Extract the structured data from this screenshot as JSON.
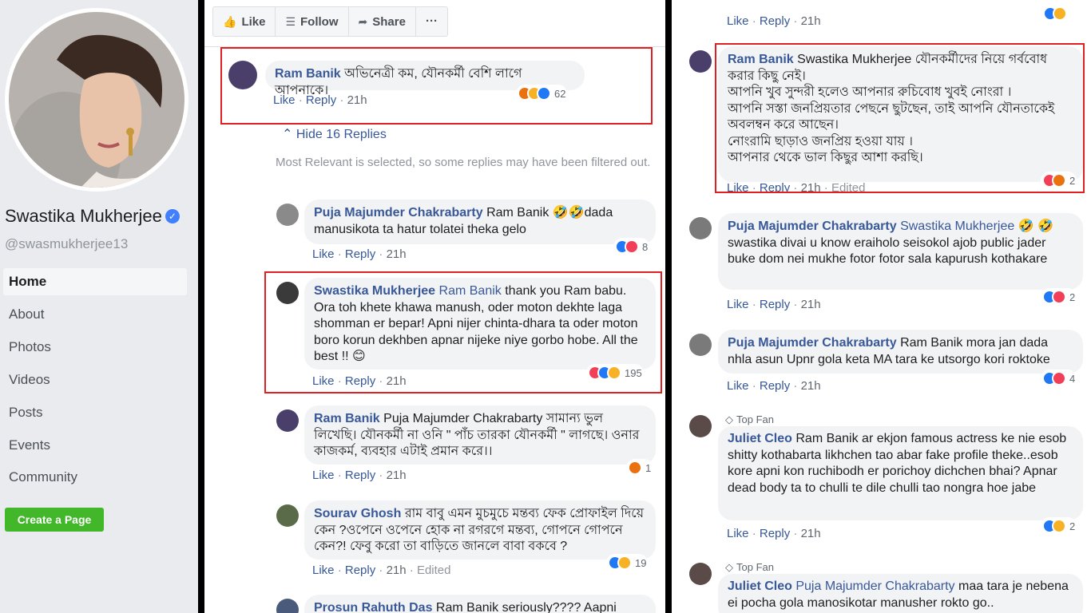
{
  "profile": {
    "name": "Swastika Mukherjee",
    "handle": "@swasmukherjee13",
    "verified_icon": "✓",
    "nav": [
      "Home",
      "About",
      "Photos",
      "Videos",
      "Posts",
      "Events",
      "Community"
    ],
    "active_nav": "Home",
    "create_page": "Create a Page"
  },
  "action_bar": {
    "like": "Like",
    "follow": "Follow",
    "share": "Share",
    "more": "···"
  },
  "meta_labels": {
    "like": "Like",
    "reply": "Reply",
    "time": "21h",
    "edited": "Edited",
    "sep": "·"
  },
  "hide_replies": "Hide 16 Replies",
  "filter_note": "Most Relevant is selected, so some replies may have been filtered out.",
  "top_fan_label": "Top Fan",
  "mid_comments": [
    {
      "author": "Ram Banik",
      "tag": "",
      "text": "অভিনেত্রী কম, যৌনকর্মী বেশি লাগে আপনাকে।",
      "reactions": "62"
    },
    {
      "author": "Puja Majumder Chakrabarty",
      "tag": "",
      "text": "Ram Banik 🤣🤣dada manusikota ta hatur tolatei theka gelo",
      "reactions": "8"
    },
    {
      "author": "Swastika Mukherjee",
      "tag": "Ram Banik",
      "text": "thank you Ram babu. Ora toh khete khawa manush, oder moton dekhte laga shomman er bepar! Apni nijer chinta-dhara ta oder moton boro korun dekhben apnar nijeke niye gorbo hobe. All the best !! 😊",
      "reactions": "195"
    },
    {
      "author": "Ram Banik",
      "tag": "",
      "text": "Puja Majumder Chakrabarty সামান্য ভুল লিখেছি। যৌনকর্মী না ওনি \" পাঁচ তারকা যৌনকর্মী \" লাগছে। ওনার কাজকর্ম, ব্যবহার এটাই প্রমান করে।।",
      "reactions": "1"
    },
    {
      "author": "Sourav Ghosh",
      "tag": "",
      "text": "রাম বাবু এমন মুচমুচে মন্তব্য ফেক প্রোফাইল দিয়ে কেন ?ওপেনে ওপেনে হোক না রগরগে মন্তব্য, গোপনে গোপনে কেন?! ফেবু করো তা বাড়িতে জানলে বাবা বকবে ?",
      "reactions": "19"
    },
    {
      "author": "Prosun Rahuth Das",
      "tag": "",
      "text": "Ram Banik seriously???? Aapni",
      "reactions": ""
    }
  ],
  "right_comments": [
    {
      "author": "Ram Banik",
      "tag": "",
      "text": "Swastika Mukherjee যৌনকর্মীদের নিয়ে গর্ববোধ করার কিছু নেই।\nআপনি খুব সুন্দরী হলেও আপনার রুচিবোধ খুবই নোংরা ।\nআপনি সস্তা জনপ্রিয়তার পেছনে ছুটছেন, তাই আপনি যৌনতাকেই অবলম্বন করে আছেন।\nনোংরামি ছাড়াও জনপ্রিয় হওয়া যায় ।\nআপনার থেকে ভাল কিছুর আশা করছি।",
      "reactions": "2"
    },
    {
      "author": "Puja Majumder Chakrabarty",
      "tag": "Swastika Mukherjee",
      "text": "🤣 🤣swastika divai u know eraiholo seisokol ajob public jader buke dom nei mukhe fotor fotor sala kapurush kothakare",
      "reactions": "2"
    },
    {
      "author": "Puja Majumder Chakrabarty",
      "tag": "",
      "text": "Ram Banik mora jan dada nhla asun Upnr gola keta MA tara ke utsorgo kori roktoke",
      "reactions": "4"
    },
    {
      "author": "Juliet Cleo",
      "tag": "",
      "text": "Ram Banik ar ekjon famous actress ke nie esob shitty kothabarta likhchen tao abar fake profile theke..esob kore apni kon ruchibodh er porichoy dichchen bhai? Apnar dead body ta to chulli te dile chulli tao nongra hoe jabe",
      "reactions": "2"
    },
    {
      "author": "Juliet Cleo",
      "tag": "Puja Majumder Chakrabarty",
      "text": "maa tara je nebena ei pocha gola manosikotar manusher rokto go..",
      "reactions": ""
    }
  ],
  "colors": {
    "link": "#385898",
    "highlight": "#e02020",
    "bubble": "#f2f3f5",
    "create_page": "#42b72a",
    "sidebar_bg": "#e9ebee"
  }
}
